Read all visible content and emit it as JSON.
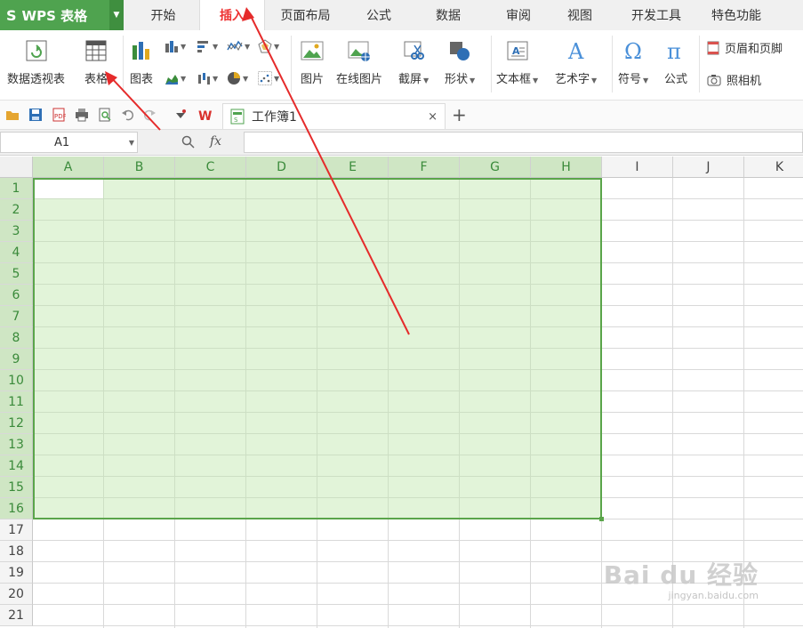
{
  "app": {
    "logo_text": "WPS 表格",
    "s_mark": "S",
    "accent": "#4fa34f"
  },
  "menu_tabs": [
    "开始",
    "插入",
    "页面布局",
    "公式",
    "数据",
    "审阅",
    "视图",
    "开发工具",
    "特色功能"
  ],
  "active_tab": "插入",
  "ribbon": {
    "pivot": "数据透视表",
    "table": "表格",
    "chart": "图表",
    "picture": "图片",
    "online_picture": "在线图片",
    "screenshot": "截屏",
    "shapes": "形状",
    "textbox": "文本框",
    "wordart": "艺术字",
    "symbol": "符号",
    "formula": "公式",
    "header_footer": "页眉和页脚",
    "camera": "照相机"
  },
  "document_tab": {
    "name": "工作簿1",
    "close": "×",
    "add": "+"
  },
  "formula_bar": {
    "cell_ref": "A1",
    "fx": "fx",
    "value": ""
  },
  "columns": [
    "A",
    "B",
    "C",
    "D",
    "E",
    "F",
    "G",
    "H",
    "I",
    "J",
    "K"
  ],
  "rows": [
    "1",
    "2",
    "3",
    "4",
    "5",
    "6",
    "7",
    "8",
    "9",
    "10",
    "11",
    "12",
    "13",
    "14",
    "15",
    "16",
    "17",
    "18",
    "19",
    "20",
    "21"
  ],
  "selection": {
    "range": "A1:H16",
    "color": "#5aa54a"
  },
  "watermark": {
    "brand": "Bai du 经验",
    "url": "jingyan.baidu.com"
  }
}
